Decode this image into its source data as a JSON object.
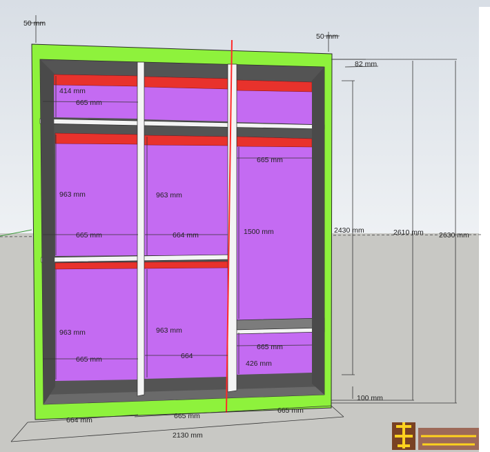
{
  "colors": {
    "frame": "#8ef23c",
    "interior": "#c46bf2",
    "strip": "#e8322c",
    "cabinet_side": "#545454",
    "sky": "#cfd6de",
    "ground": "#c8c8c4",
    "section_line": "#ff2a2a"
  },
  "labels": {
    "top_left_50": "50 mm",
    "top_right_50": "50 mm",
    "depth_82": "82 mm",
    "strip_414": "414 mm",
    "left_top_665": "665 mm",
    "right_top_665": "665 mm",
    "left_h_963": "963 mm",
    "mid_h_963": "963 mm",
    "right_h_1500": "1500 mm",
    "left_mid_665": "665 mm",
    "mid_mid_664": "664 mm",
    "left_h2_963": "963 mm",
    "mid_h2_963": "963 mm",
    "left_bot_665": "665 mm",
    "mid_bot_664": "664",
    "right_bot_665": "665 mm",
    "right_h_426": "426 mm",
    "plinth_100": "100 mm",
    "height_2430": "2430 mm",
    "height_2610": "2610 mm",
    "height_2630": "2630 mm",
    "base_664": "664 mm",
    "base_665_mid": "665 mm",
    "base_665_right": "665 mm",
    "total_2130": "2130 mm"
  }
}
